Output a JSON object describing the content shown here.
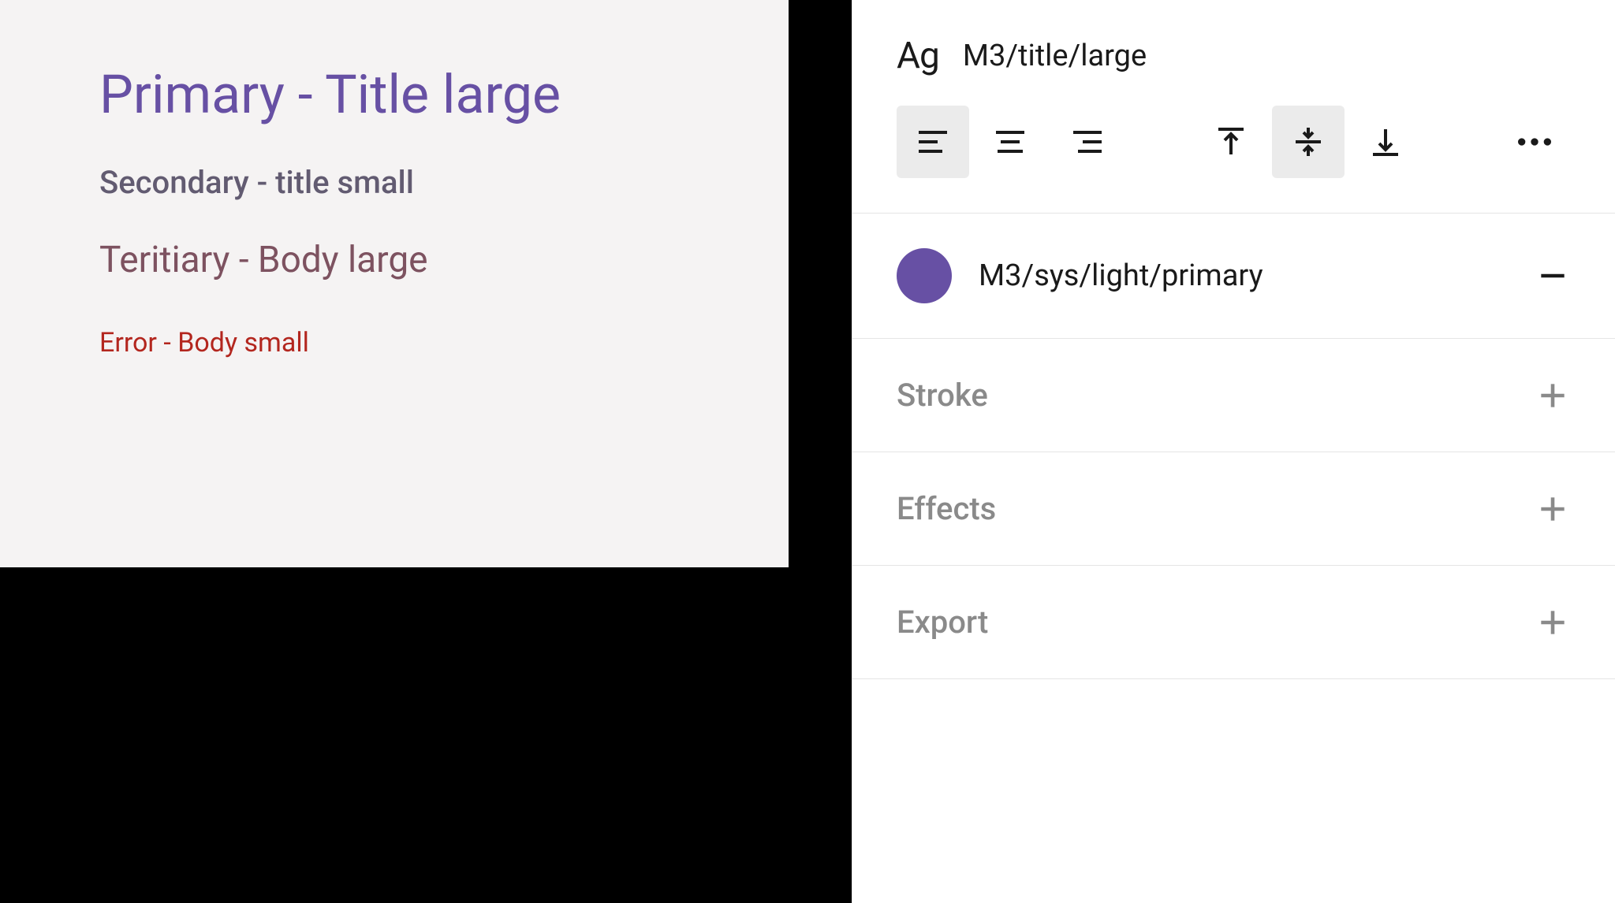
{
  "canvas": {
    "primary_text": "Primary - Title large",
    "secondary_text": "Secondary - title small",
    "tertiary_text": "Teritiary - Body large",
    "error_text": "Error - Body small"
  },
  "inspector": {
    "text_style": {
      "ag": "Ag",
      "name": "M3/title/large"
    },
    "fill": {
      "swatch_color": "#6750A4",
      "name": "M3/sys/light/primary"
    },
    "panels": {
      "stroke": "Stroke",
      "effects": "Effects",
      "export": "Export"
    }
  }
}
